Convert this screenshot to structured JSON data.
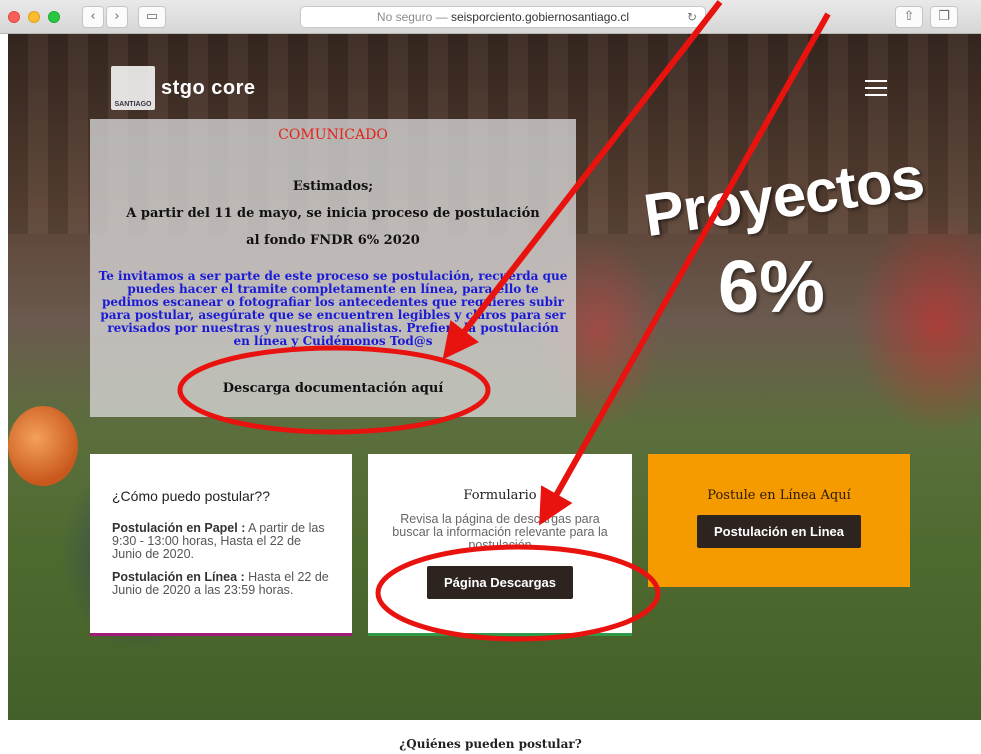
{
  "browser": {
    "url_prefix": "No seguro —",
    "url_domain": "seisporciento.gobiernosantiago.cl",
    "back_icon": "chevron-left-icon",
    "forward_icon": "chevron-right-icon"
  },
  "header": {
    "logo_text": "stgo core",
    "logo_subtext": "SANTIAGO"
  },
  "communique": {
    "title": "COMUNICADO",
    "greeting": "Estimados;",
    "line1": "A partir del 11 de mayo, se inicia proceso de postulación",
    "line2": "al fondo FNDR 6% 2020",
    "body": "Te invitamos a ser parte de este proceso se postulación, recuerda que puedes hacer el tramite completamente en línea, para ello te pedimos escanear o fotografiar los antecedentes que requieres subir para postular, asegúrate que se encuentren legibles y claros para ser revisados por nuestras y nuestros analistas. Prefiere la postulación en línea y Cuidémonos Tod@s",
    "download": "Descarga documentación aquí"
  },
  "promo": {
    "line1": "Proyectos",
    "line2": "6%"
  },
  "cards": {
    "how": {
      "title": "¿Cómo puedo postular??",
      "paper_label": "Postulación en Papel :",
      "paper_text": " A partir de las 9:30 - 13:00 horas, Hasta el 22 de Junio de 2020.",
      "online_label": "Postulación en Línea :",
      "online_text": " Hasta el 22 de Junio de 2020 a las 23:59 horas."
    },
    "form": {
      "title": "Formulario",
      "text": "Revisa la página de descargas para buscar la información relevante para la postulación",
      "button": "Página Descargas"
    },
    "online": {
      "title": "Postule en Línea Aquí",
      "button": "Postulación en Linea"
    }
  },
  "below": {
    "heading": "¿Quiénes pueden postular?"
  },
  "colors": {
    "annotation_red": "#e8120f",
    "comm_title_red": "#e2231a",
    "comm_blue": "#1a1ad6",
    "online_card": "#f59b00",
    "button_dark": "#2d2420"
  }
}
